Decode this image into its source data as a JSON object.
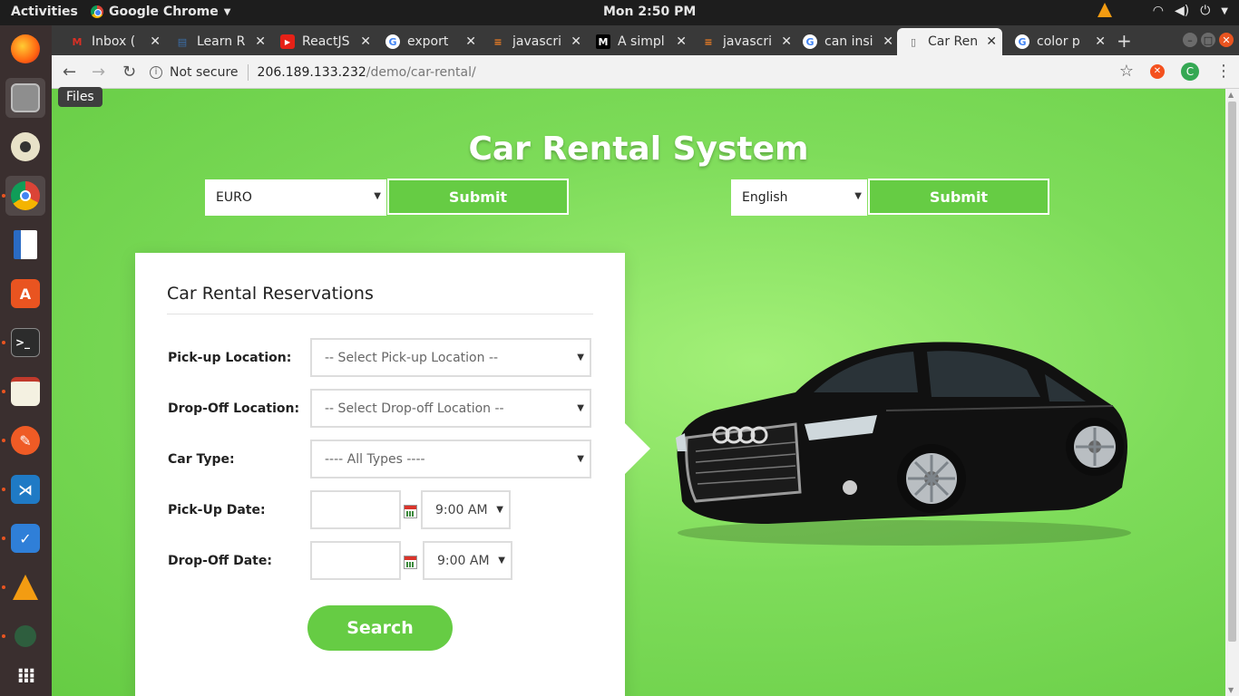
{
  "system": {
    "activities": "Activities",
    "app_name": "Google Chrome",
    "clock": "Mon  2:50 PM"
  },
  "dock": {
    "tooltip": "Files",
    "items": [
      "firefox-icon",
      "files-icon",
      "rhythmbox-icon",
      "chrome-icon",
      "writer-icon",
      "software-icon",
      "terminal-icon",
      "text-editor-icon",
      "postman-icon",
      "vscode-icon",
      "tasks-icon",
      "vlc-icon",
      "eclipse-icon",
      "apps-grid-icon"
    ]
  },
  "browser": {
    "tabs": [
      {
        "title": "Inbox (",
        "icon": "gmail-icon"
      },
      {
        "title": "Learn R",
        "icon": "book-icon"
      },
      {
        "title": "ReactJS",
        "icon": "youtube-icon"
      },
      {
        "title": "export",
        "icon": "google-icon"
      },
      {
        "title": "javascri",
        "icon": "stackoverflow-icon"
      },
      {
        "title": "A simpl",
        "icon": "medium-icon"
      },
      {
        "title": "javascri",
        "icon": "stackoverflow-icon"
      },
      {
        "title": "can insi",
        "icon": "google-icon"
      },
      {
        "title": "Car Ren",
        "icon": "page-icon",
        "active": true
      },
      {
        "title": "color p",
        "icon": "google-icon"
      }
    ],
    "security_label": "Not secure",
    "url_host": "206.189.133.232",
    "url_path": "/demo/car-rental/",
    "profile_initial": "C"
  },
  "page": {
    "title": "Car Rental System",
    "currency": {
      "value": "EURO",
      "submit": "Submit"
    },
    "language": {
      "value": "English",
      "submit": "Submit"
    },
    "form": {
      "title": "Car Rental Reservations",
      "pickup_location_label": "Pick-up Location:",
      "pickup_location_value": "-- Select Pick-up Location --",
      "dropoff_location_label": "Drop-Off Location:",
      "dropoff_location_value": "-- Select Drop-off Location --",
      "car_type_label": "Car Type:",
      "car_type_value": "---- All Types ----",
      "pickup_date_label": "Pick-Up Date:",
      "pickup_time": "9:00 AM",
      "dropoff_date_label": "Drop-Off Date:",
      "dropoff_time": "9:00 AM",
      "search_label": "Search"
    }
  },
  "colors": {
    "accent_green": "#66cc44",
    "ubuntu_orange": "#e95420"
  }
}
